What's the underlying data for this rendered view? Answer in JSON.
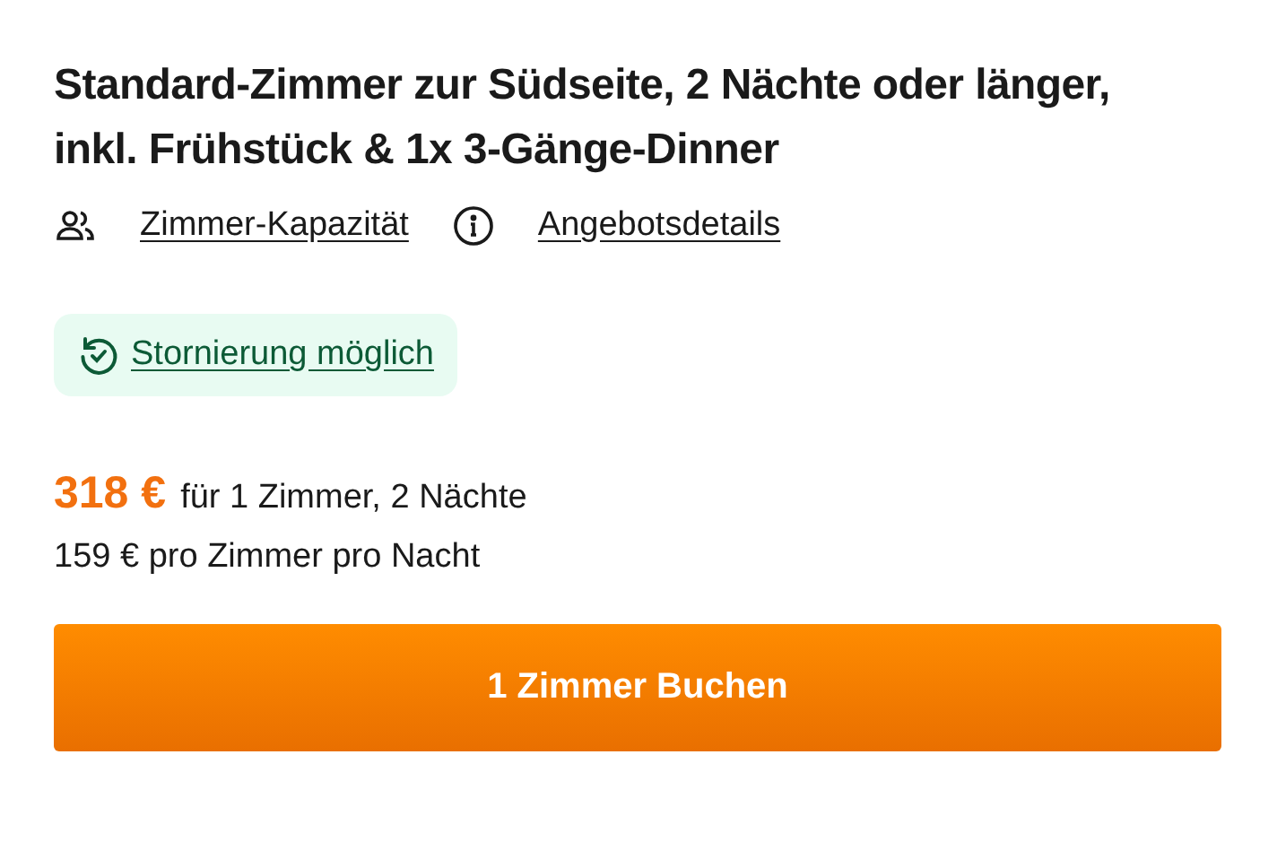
{
  "title": "Standard-Zimmer zur Südseite, 2 Nächte oder länger, inkl. Frühstück & 1x 3-Gänge-Dinner",
  "links": [
    {
      "kind": "capacity",
      "label": "Zimmer-Kapazität"
    },
    {
      "kind": "info",
      "label": "Angebotsdetails"
    }
  ],
  "cancellation": {
    "label": "Stornierung möglich"
  },
  "price": {
    "amount": "318 €",
    "details": "für 1 Zimmer, 2 Nächte",
    "per_night": "159 € pro Zimmer pro Nacht"
  },
  "book_button": "1 Zimmer Buchen"
}
